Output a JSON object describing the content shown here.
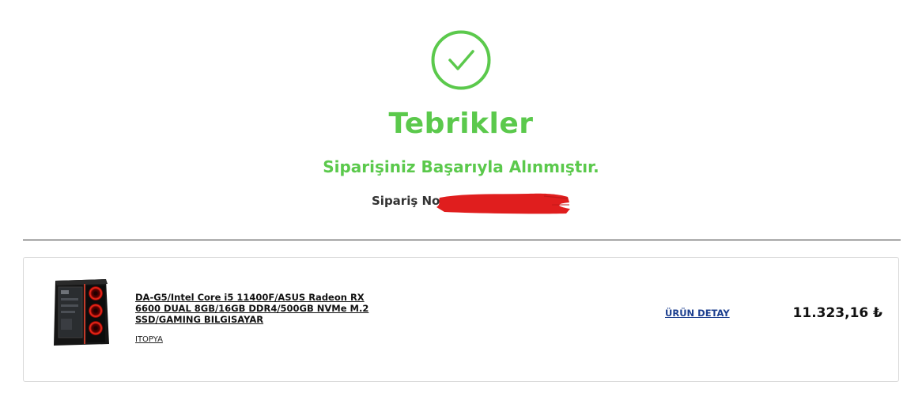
{
  "success": {
    "icon": "check-circle-icon",
    "title": "Tebrikler",
    "subtitle": "Siparişiniz Başarıyla Alınmıştır.",
    "order_label": "Sipariş No"
  },
  "colors": {
    "success_green": "#5bc94c",
    "link_blue": "#1c3f8f",
    "redaction_red": "#e01e1e"
  },
  "order_items": [
    {
      "name": "DA-G5/Intel Core i5 11400F/ASUS Radeon RX 6600 DUAL 8GB/16GB DDR4/500GB NVMe M.2 SSD/GAMING BILGISAYAR",
      "brand": "ITOPYA",
      "detail_label": "ÜRÜN DETAY",
      "price": "11.323,16 ₺",
      "image": "gaming-pc-case-image"
    }
  ]
}
